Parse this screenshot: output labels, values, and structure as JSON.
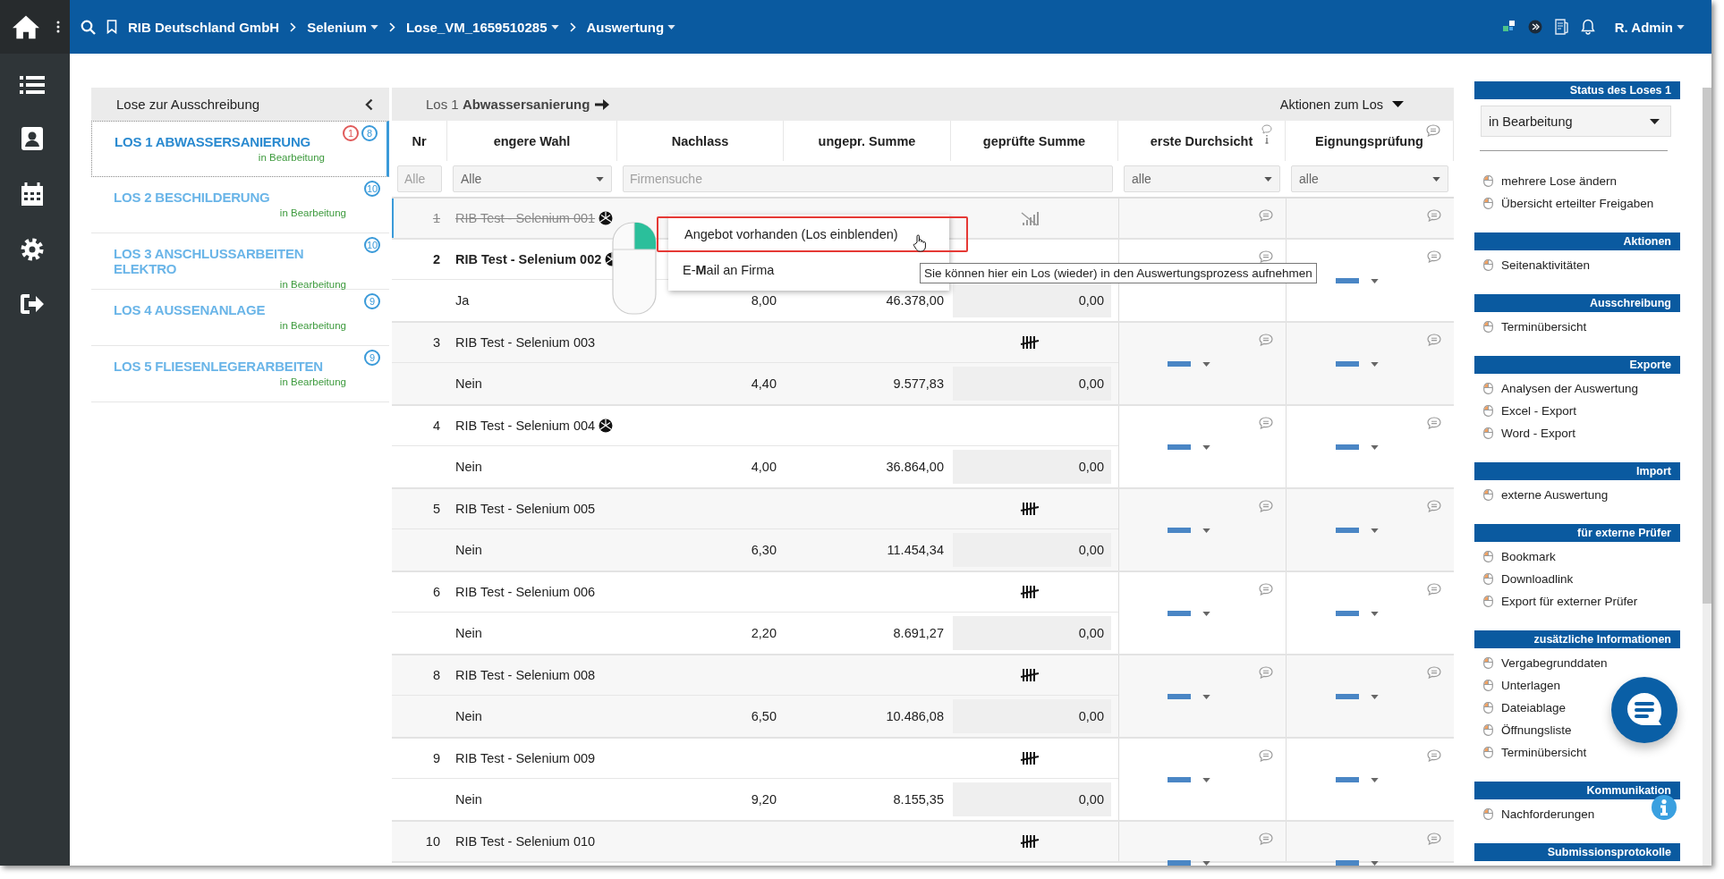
{
  "topbar": {
    "breadcrumbs": [
      {
        "label": "RIB Deutschland GmbH",
        "dropdown": false
      },
      {
        "label": "Selenium",
        "dropdown": true
      },
      {
        "label": "Lose_VM_1659510285",
        "dropdown": true
      },
      {
        "label": "Auswertung",
        "dropdown": true
      }
    ],
    "user": "R. Admin"
  },
  "lots_panel": {
    "title": "Lose zur Ausschreibung",
    "items": [
      {
        "title": "LOS 1 ABWASSERSANIERUNG",
        "status": "in Bearbeitung",
        "selected": true,
        "counts": [
          {
            "text": "1",
            "color": "#e05a5a"
          },
          {
            "text": "8",
            "color": "#3a9ad9"
          }
        ]
      },
      {
        "title": "LOS 2 BESCHILDERUNG",
        "status": "in Bearbeitung",
        "selected": false,
        "counts": [
          {
            "text": "10",
            "color": "#3a9ad9"
          }
        ]
      },
      {
        "title": "LOS 3 ANSCHLUSSARBEITEN ELEKTRO",
        "status": "in Bearbeitung",
        "selected": false,
        "counts": [
          {
            "text": "10",
            "color": "#3a9ad9"
          }
        ]
      },
      {
        "title": "LOS 4 AUSSENANLAGE",
        "status": "in Bearbeitung",
        "selected": false,
        "counts": [
          {
            "text": "9",
            "color": "#3a9ad9"
          }
        ]
      },
      {
        "title": "LOS 5 FLIESENLEGERARBEITEN",
        "status": "in Bearbeitung",
        "selected": false,
        "counts": [
          {
            "text": "9",
            "color": "#3a9ad9"
          }
        ]
      }
    ]
  },
  "lot_header": {
    "title": "Los 1 **Abwassersanierung**",
    "actions": "Aktionen zum Los"
  },
  "table": {
    "columns": [
      "Nr",
      "engere Wahl",
      "Nachlass",
      "ungepr. Summe",
      "geprüfte Summe",
      "erste Durchsicht",
      "Eignungsprüfung"
    ],
    "filters": [
      {
        "kind": "field",
        "placeholder": "Alle"
      },
      {
        "kind": "select",
        "value": "Alle"
      },
      {
        "kind": "field",
        "placeholder": "Firmensuche"
      },
      {
        "kind": "select",
        "value": "alle"
      },
      {
        "kind": "select",
        "value": "alle"
      }
    ],
    "rows": [
      {
        "nr": "1",
        "company": "RIB Test - Selenium 001",
        "selected": true,
        "excluded": true,
        "highlighted": false,
        "ball": true,
        "tallied": false
      },
      {
        "nr": "2",
        "company": "RIB Test - Selenium 002",
        "selected": false,
        "excluded": false,
        "highlighted": true,
        "ball": true,
        "tallied": false,
        "detail": {
          "shortlist": "Ja",
          "discount": "8,00",
          "unchecked_sum": "46.378,00",
          "checked_sum": "0,00"
        }
      },
      {
        "nr": "3",
        "company": "RIB Test - Selenium 003",
        "selected": false,
        "excluded": false,
        "highlighted": false,
        "ball": false,
        "tallied": true,
        "detail": {
          "shortlist": "Nein",
          "discount": "4,40",
          "unchecked_sum": "9.577,83",
          "checked_sum": "0,00"
        }
      },
      {
        "nr": "4",
        "company": "RIB Test - Selenium 004",
        "selected": false,
        "excluded": false,
        "highlighted": false,
        "ball": true,
        "tallied": false,
        "detail": {
          "shortlist": "Nein",
          "discount": "4,00",
          "unchecked_sum": "36.864,00",
          "checked_sum": "0,00"
        }
      },
      {
        "nr": "5",
        "company": "RIB Test - Selenium 005",
        "selected": false,
        "excluded": false,
        "highlighted": false,
        "ball": false,
        "tallied": true,
        "detail": {
          "shortlist": "Nein",
          "discount": "6,30",
          "unchecked_sum": "11.454,34",
          "checked_sum": "0,00"
        }
      },
      {
        "nr": "6",
        "company": "RIB Test - Selenium 006",
        "selected": false,
        "excluded": false,
        "highlighted": false,
        "ball": false,
        "tallied": true,
        "detail": {
          "shortlist": "Nein",
          "discount": "2,20",
          "unchecked_sum": "8.691,27",
          "checked_sum": "0,00"
        }
      },
      {
        "nr": "8",
        "company": "RIB Test - Selenium 008",
        "selected": false,
        "excluded": false,
        "highlighted": false,
        "ball": false,
        "tallied": true,
        "detail": {
          "shortlist": "Nein",
          "discount": "6,50",
          "unchecked_sum": "10.486,08",
          "checked_sum": "0,00"
        }
      },
      {
        "nr": "9",
        "company": "RIB Test - Selenium 009",
        "selected": false,
        "excluded": false,
        "highlighted": false,
        "ball": false,
        "tallied": true,
        "detail": {
          "shortlist": "Nein",
          "discount": "9,20",
          "unchecked_sum": "8.155,35",
          "checked_sum": "0,00"
        }
      },
      {
        "nr": "10",
        "company": "RIB Test - Selenium 010",
        "selected": false,
        "excluded": false,
        "highlighted": false,
        "ball": false,
        "tallied": true
      }
    ]
  },
  "context_menu": {
    "items": [
      {
        "label": "Angebot vorhanden (Los einblenden)",
        "selected": true
      },
      {
        "label": "E-**M**ail an Firma",
        "selected": false
      }
    ]
  },
  "tooltip": "Sie können hier ein Los (wieder) in den Auswertungsprozess aufnehmen",
  "sidebar": {
    "status": {
      "title": "Status des Loses 1",
      "value": "in Bearbeitung",
      "links": [
        "mehrere Lose ändern",
        "Übersicht erteilter Freigaben"
      ]
    },
    "sections": [
      {
        "title": "Aktionen",
        "items": [
          "Seitenaktivitäten"
        ]
      },
      {
        "title": "Ausschreibung",
        "items": [
          "Terminübersicht"
        ]
      },
      {
        "title": "Exporte",
        "items": [
          "Analysen der Auswertung",
          "Excel - Export",
          "Word - Export"
        ]
      },
      {
        "title": "Import",
        "items": [
          "externe Auswertung"
        ]
      },
      {
        "title": "für externe Prüfer",
        "items": [
          "Bookmark",
          "Downloadlink",
          "Export für externer Prüfer"
        ]
      },
      {
        "title": "zusätzliche Informationen",
        "items": [
          "Vergabegrunddaten",
          "Unterlagen",
          "Dateiablage",
          "Öffnungsliste",
          "Terminübersicht"
        ]
      },
      {
        "title": "Kommunikation",
        "items": [
          "Nachforderungen"
        ]
      },
      {
        "title": "Submissionsprotokolle"
      }
    ]
  }
}
